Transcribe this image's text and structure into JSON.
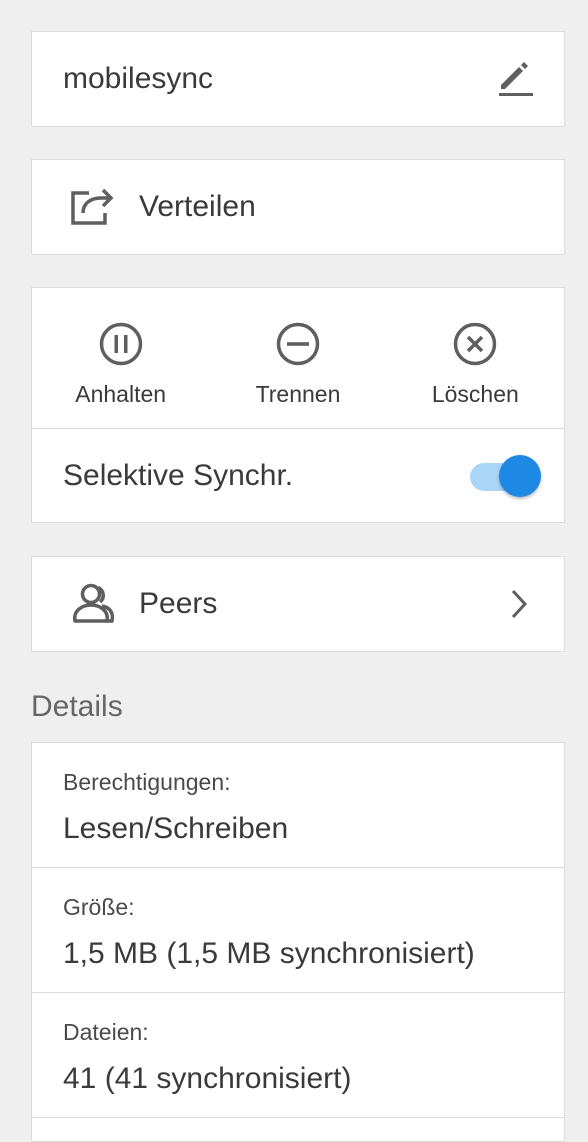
{
  "folder": {
    "name": "mobilesync"
  },
  "share": {
    "label": "Verteilen"
  },
  "actions": [
    {
      "label": "Anhalten",
      "icon": "pause-circle-icon"
    },
    {
      "label": "Trennen",
      "icon": "minus-circle-icon"
    },
    {
      "label": "Löschen",
      "icon": "close-circle-icon"
    }
  ],
  "selective_sync": {
    "label": "Selektive Synchr.",
    "enabled": true
  },
  "peers": {
    "label": "Peers"
  },
  "details": {
    "title": "Details",
    "items": [
      {
        "label": "Berechtigungen:",
        "value": "Lesen/Schreiben"
      },
      {
        "label": "Größe:",
        "value": "1,5 MB (1,5 MB synchronisiert)"
      },
      {
        "label": "Dateien:",
        "value": "41 (41 synchronisiert)"
      }
    ]
  },
  "colors": {
    "accent": "#1e88e5",
    "track": "#a9d6f7",
    "icon": "#5f5f5f",
    "background": "#efefef"
  }
}
